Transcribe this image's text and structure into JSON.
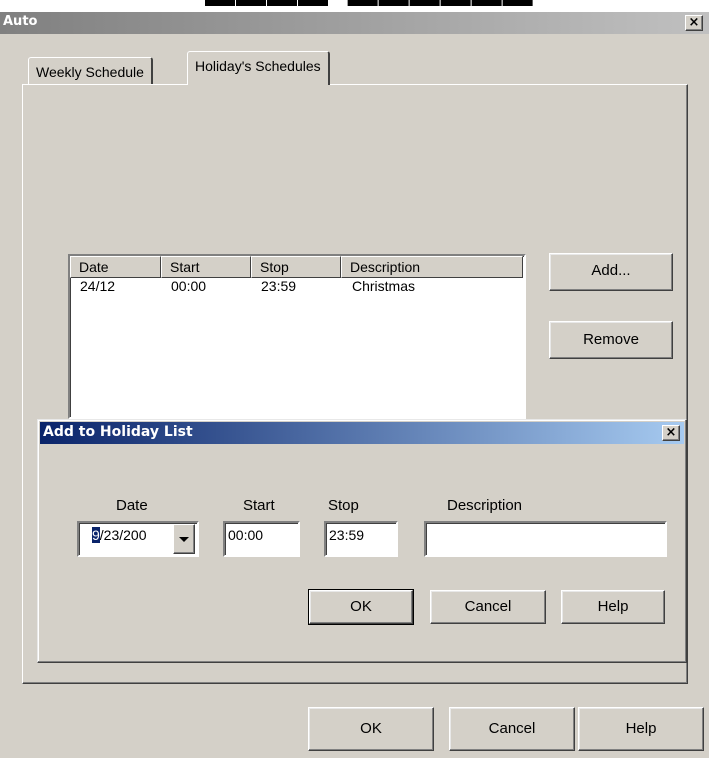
{
  "outer_window": {
    "title": "Auto",
    "close_glyph": "×",
    "tabs": [
      {
        "label": "Weekly Schedule",
        "active": false
      },
      {
        "label": "Holiday's Schedules",
        "active": true
      }
    ],
    "buttons": {
      "ok": "OK",
      "cancel": "Cancel",
      "help": "Help"
    }
  },
  "holiday_list": {
    "columns": [
      "Date",
      "Start",
      "Stop",
      "Description"
    ],
    "rows": [
      {
        "date": "24/12",
        "start": "00:00",
        "stop": "23:59",
        "description": "Christmas"
      }
    ],
    "add_button": "Add...",
    "remove_button": "Remove"
  },
  "add_dialog": {
    "title": "Add to Holiday List",
    "close_glyph": "×",
    "labels": {
      "date": "Date",
      "start": "Start",
      "stop": "Stop",
      "description": "Description"
    },
    "date_value_selected": "9",
    "date_value_rest": "/23/200",
    "start_value": "00:00",
    "stop_value": "23:59",
    "description_value": "",
    "buttons": {
      "ok": "OK",
      "cancel": "Cancel",
      "help": "Help"
    }
  },
  "colors": {
    "dialog_face": "#d4d0c8",
    "active_title_start": "#0a246a",
    "active_title_end": "#a6caf0",
    "inactive_title": "#808080"
  }
}
